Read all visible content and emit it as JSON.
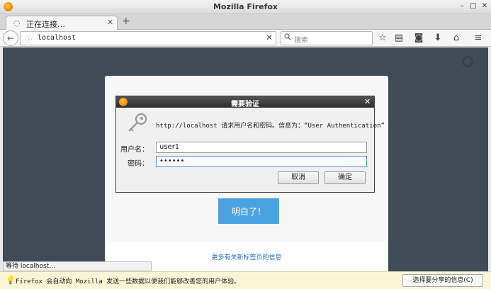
{
  "window": {
    "title": "Mozilla Firefox"
  },
  "tab": {
    "label": "正在连接…"
  },
  "navbar": {
    "url": "localhost",
    "search_placeholder": "搜索"
  },
  "card": {
    "heading": "",
    "button_label": "明白了！",
    "more_link": "更多有关新标签页的信息"
  },
  "dialog": {
    "title": "需要验证",
    "message": "http://localhost 请求用户名和密码。信息为：“User Authentication”",
    "username_label": "用户名：",
    "username_value": "user1",
    "password_label": "密码：",
    "password_value": "••••••",
    "cancel_label": "取消",
    "ok_label": "确定"
  },
  "status": {
    "text": "等待 localhost…"
  },
  "notification": {
    "text": "Firefox 会自动向 Mozilla 发送一些数据以便我们能够改善您的用户体验。",
    "button_label": "选择要分享的信息(C)"
  },
  "colors": {
    "content_bg": "#3f4b57",
    "accent": "#4aa3df",
    "notification_bg": "#fbf5d8"
  }
}
